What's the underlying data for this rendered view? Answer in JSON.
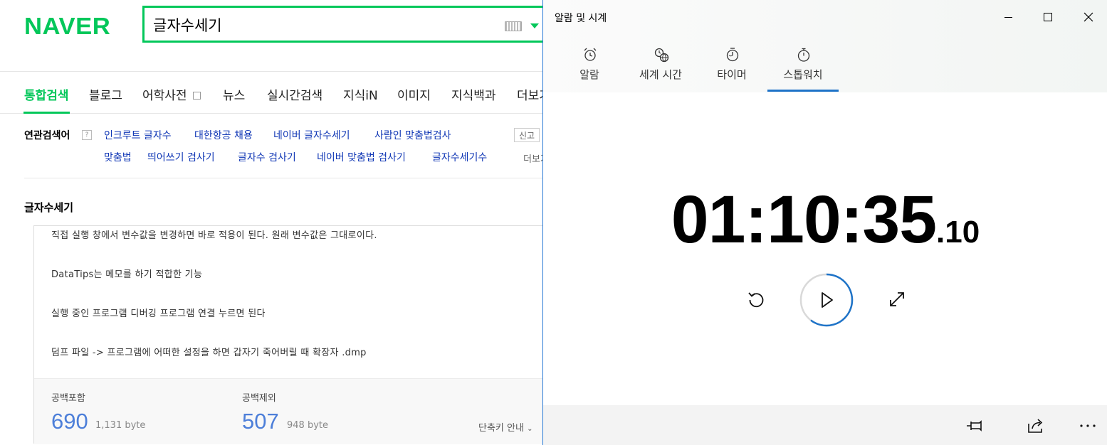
{
  "naver": {
    "logo": "NAVER",
    "search_value": "글자수세기",
    "tabs": [
      "통합검색",
      "블로그",
      "어학사전",
      "뉴스",
      "실시간검색",
      "지식iN",
      "이미지",
      "지식백과",
      "더보기"
    ],
    "related": {
      "title": "연관검색어",
      "help": "?",
      "row1": [
        "인크루트 글자수",
        "대한항공 채용",
        "네이버 글자수세기",
        "사람인 맞춤법검사"
      ],
      "row2": [
        "맞춤법",
        "띄어쓰기 검사기",
        "글자수 검사기",
        "네이버 맞춤법 검사기",
        "글자수세기수"
      ],
      "report": "신고",
      "more": "더보기"
    },
    "section_title": "글자수세기",
    "text_lines": [
      "직접 실행 창에서 변수값을 변경하면 바로 적용이 된다. 원래 변수값은 그대로이다.",
      "DataTips는 메모를 하기 적합한 기능",
      "실행 중인 프로그램 디버깅 프로그램 연결 누르면 된다",
      "덤프 파일 -> 프로그램에 어떠한 설정을 하면 갑자기 죽어버릴 때 확장자 .dmp"
    ],
    "counter": {
      "with_space_label": "공백포함",
      "with_space_value": "690",
      "with_space_bytes": "1,131 byte",
      "without_space_label": "공백제외",
      "without_space_value": "507",
      "without_space_bytes": "948 byte",
      "shortcut": "단축키 안내"
    }
  },
  "clock": {
    "window_title": "알람 및 시계",
    "tabs": [
      "알람",
      "세계 시간",
      "타이머",
      "스톱워치"
    ],
    "active_tab": "스톱워치",
    "time_main": "01:10:35",
    "time_fraction": ".10",
    "accent": "#1e73c8"
  },
  "colors": {
    "naver_green": "#03c75a",
    "link_blue": "#0f36b5",
    "count_blue": "#4d7fd9"
  }
}
